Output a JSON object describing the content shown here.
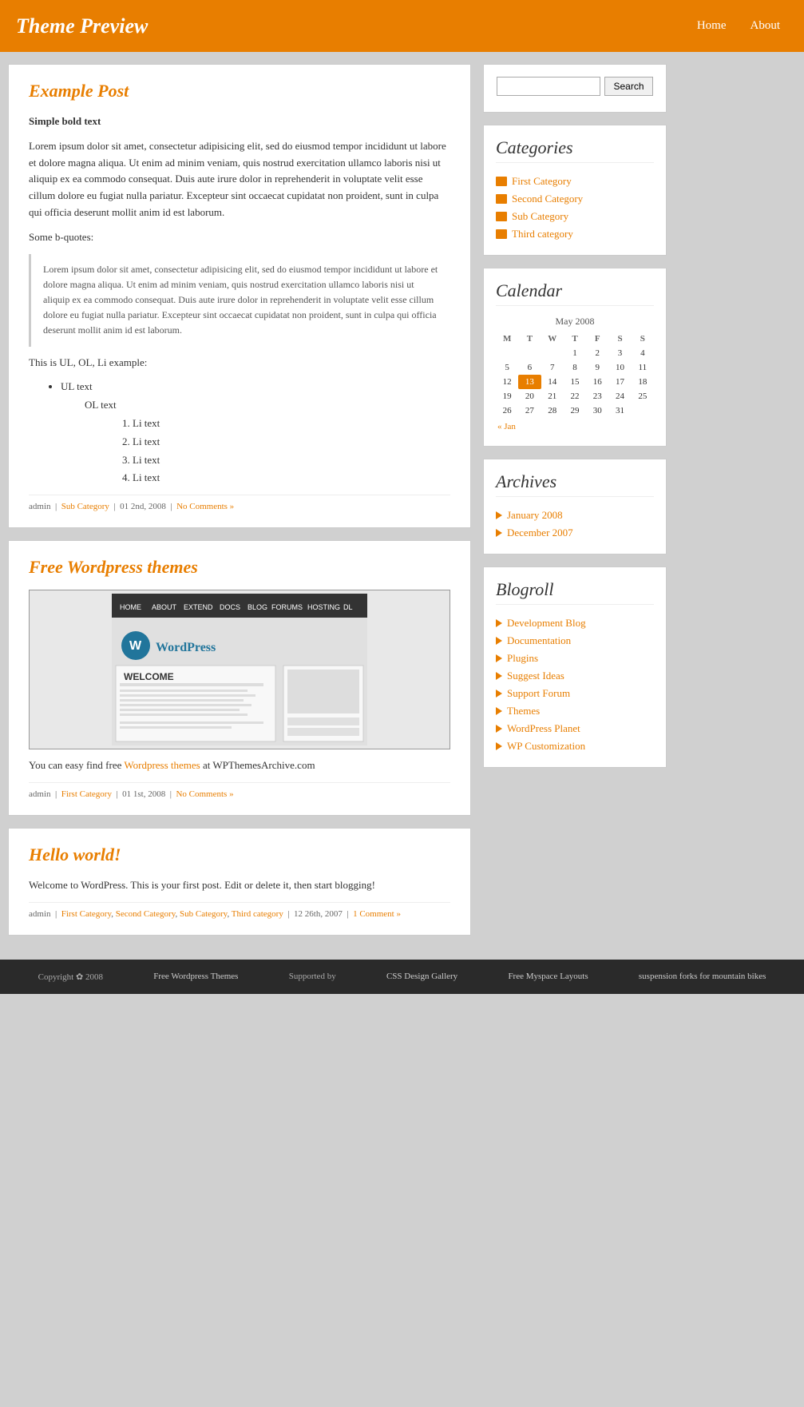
{
  "header": {
    "title": "Theme Preview",
    "nav": [
      {
        "label": "Home",
        "href": "#"
      },
      {
        "label": "About",
        "href": "#"
      }
    ]
  },
  "search": {
    "placeholder": "",
    "button_label": "Search"
  },
  "sidebar": {
    "categories_title": "Categories",
    "categories": [
      {
        "label": "First Category",
        "href": "#"
      },
      {
        "label": "Second Category",
        "href": "#"
      },
      {
        "label": "Sub Category",
        "href": "#"
      },
      {
        "label": "Third category",
        "href": "#"
      }
    ],
    "calendar_title": "Calendar",
    "calendar_month": "May 2008",
    "calendar_days_header": [
      "M",
      "T",
      "W",
      "T",
      "F",
      "S",
      "S"
    ],
    "calendar_weeks": [
      [
        "",
        "",
        "",
        "1",
        "2",
        "3",
        "4"
      ],
      [
        "5",
        "6",
        "7",
        "8",
        "9",
        "10",
        "11"
      ],
      [
        "12",
        "13",
        "14",
        "15",
        "16",
        "17",
        "18"
      ],
      [
        "19",
        "20",
        "21",
        "22",
        "23",
        "24",
        "25"
      ],
      [
        "26",
        "27",
        "28",
        "29",
        "30",
        "31",
        ""
      ]
    ],
    "calendar_today": "13",
    "calendar_prev": "« Jan",
    "archives_title": "Archives",
    "archives": [
      {
        "label": "January 2008",
        "href": "#"
      },
      {
        "label": "December 2007",
        "href": "#"
      }
    ],
    "blogroll_title": "Blogroll",
    "blogroll": [
      {
        "label": "Development Blog",
        "href": "#"
      },
      {
        "label": "Documentation",
        "href": "#"
      },
      {
        "label": "Plugins",
        "href": "#"
      },
      {
        "label": "Suggest Ideas",
        "href": "#"
      },
      {
        "label": "Support Forum",
        "href": "#"
      },
      {
        "label": "Themes",
        "href": "#"
      },
      {
        "label": "WordPress Planet",
        "href": "#"
      },
      {
        "label": "WP Customization",
        "href": "#"
      }
    ]
  },
  "posts": [
    {
      "id": "post1",
      "title": "Example Post",
      "bold_label": "Simple bold text",
      "body_para1": "Lorem ipsum dolor sit amet, consectetur adipisicing elit, sed do eiusmod tempor incididunt ut labore et dolore magna aliqua. Ut enim ad minim veniam, quis nostrud exercitation ullamco laboris nisi ut aliquip ex ea commodo consequat. Duis aute irure dolor in reprehenderit in voluptate velit esse cillum dolore eu fugiat nulla pariatur. Excepteur sint occaecat cupidatat non proident, sunt in culpa qui officia deserunt mollit anim id est laborum.",
      "bquotes_label": "Some b-quotes:",
      "blockquote": "Lorem ipsum dolor sit amet, consectetur adipisicing elit, sed do eiusmod tempor incididunt ut labore et dolore magna aliqua. Ut enim ad minim veniam, quis nostrud exercitation ullamco laboris nisi ut aliquip ex ea commodo consequat. Duis aute irure dolor in reprehenderit in voluptate velit esse cillum dolore eu fugiat nulla pariatur. Excepteur sint occaecat cupidatat non proident, sunt in culpa qui officia deserunt mollit anim id est laborum.",
      "ul_label": "This is UL, OL, Li example:",
      "ul_text": "UL text",
      "ol_text": "OL text",
      "li_items": [
        "Li text",
        "Li text",
        "Li text",
        "Li text"
      ],
      "meta_author": "admin",
      "meta_category_label": "Sub Category",
      "meta_date": "01 2nd, 2008",
      "meta_comments": "No Comments »"
    },
    {
      "id": "post2",
      "title": "Free Wordpress themes",
      "body_text": "You can easy find free ",
      "body_link_text": "Wordpress themes",
      "body_text2": " at WPThemesArchive.com",
      "meta_author": "admin",
      "meta_category_label": "First Category",
      "meta_date": "01 1st, 2008",
      "meta_comments": "No Comments »"
    },
    {
      "id": "post3",
      "title": "Hello world!",
      "body_text": "Welcome to WordPress. This is your first post. Edit or delete it, then start blogging!",
      "meta_author": "admin",
      "meta_categories": [
        "First Category",
        "Second Category",
        "Sub Category",
        "Third category"
      ],
      "meta_date": "12 26th, 2007",
      "meta_comments": "1 Comment »"
    }
  ],
  "footer": {
    "copyright": "Copyright ✿ 2008",
    "links": [
      {
        "label": "Free Wordpress Themes"
      },
      {
        "label": "Supported by"
      },
      {
        "label": "CSS Design Gallery"
      },
      {
        "label": "Free Myspace Layouts"
      },
      {
        "label": "suspension forks for mountain bikes"
      }
    ]
  }
}
